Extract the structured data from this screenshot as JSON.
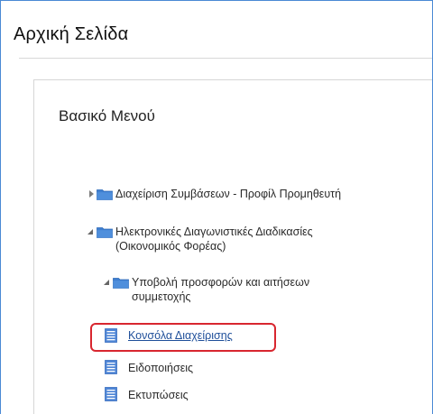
{
  "page": {
    "title": "Αρχική Σελίδα"
  },
  "panel": {
    "title": "Βασικό Μενού"
  },
  "tree": {
    "item1": {
      "label": "Διαχείριση Συμβάσεων - Προφίλ Προμηθευτή",
      "state": "collapsed",
      "icon": "folder-icon"
    },
    "item2": {
      "label_line1": "Ηλεκτρονικές Διαγωνιστικές Διαδικασίες",
      "label_line2": "(Οικονομικός Φορέας)",
      "state": "expanded",
      "icon": "folder-icon"
    },
    "item3": {
      "label_line1": "Υποβολή προσφορών και αιτήσεων",
      "label_line2": "συμμετοχής",
      "state": "expanded",
      "icon": "folder-icon"
    },
    "item4": {
      "label": "Κονσόλα Διαχείρισης",
      "icon": "document-icon",
      "highlighted": true
    },
    "item5": {
      "label": "Ειδοποιήσεις",
      "icon": "document-icon"
    },
    "item6": {
      "label": "Εκτυπώσεις",
      "icon": "document-icon"
    }
  },
  "colors": {
    "frame_border": "#4a89d4",
    "folder": "#3f7fd0",
    "document": "#4f86d6",
    "highlight": "#d8262f",
    "link": "#1f4f9a"
  }
}
